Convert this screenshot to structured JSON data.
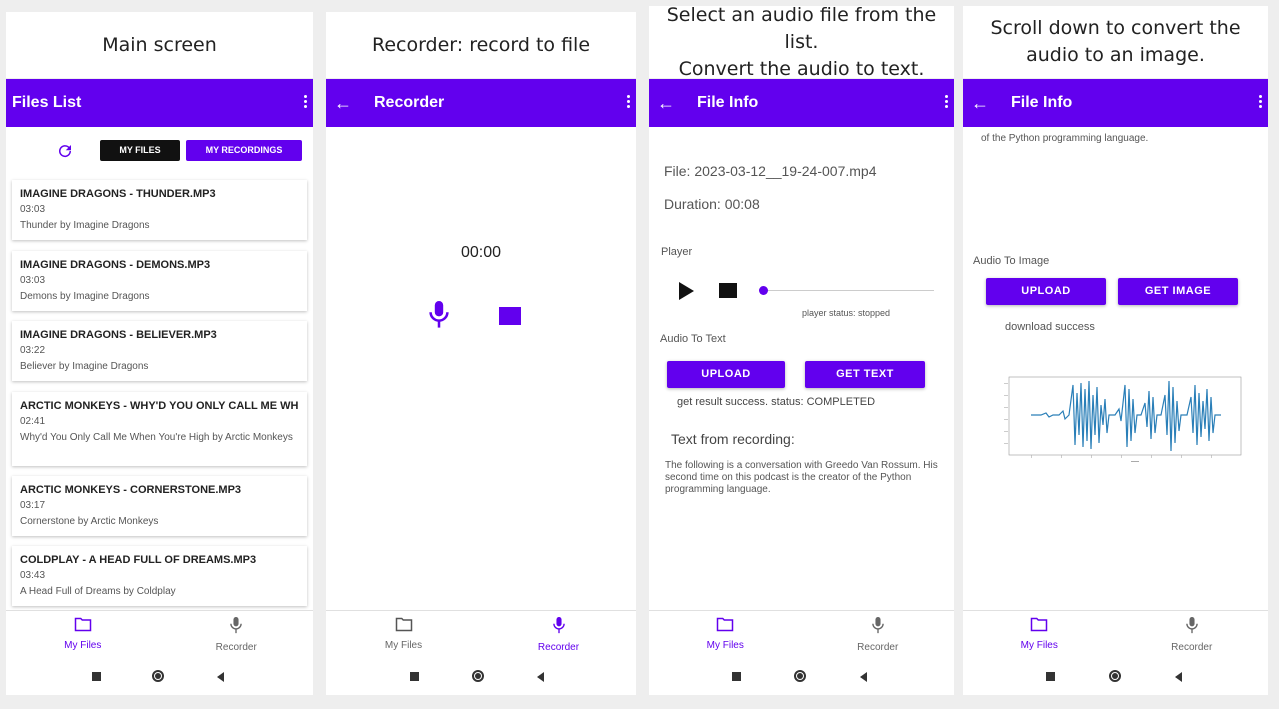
{
  "captions": [
    "Main screen",
    "Recorder: record to file",
    "Select an audio file from the list.\nConvert the audio to text.",
    "Scroll down to convert the\naudio to an image."
  ],
  "nav": {
    "files": "My Files",
    "recorder": "Recorder"
  },
  "screen1": {
    "title": "Files List",
    "tab_files": "MY FILES",
    "tab_recordings": "MY RECORDINGS",
    "items": [
      {
        "title": "IMAGINE DRAGONS - THUNDER.MP3",
        "duration": "03:03",
        "subtitle": "Thunder by Imagine Dragons"
      },
      {
        "title": "IMAGINE DRAGONS - DEMONS.MP3",
        "duration": "03:03",
        "subtitle": "Demons by Imagine Dragons"
      },
      {
        "title": "IMAGINE DRAGONS - BELIEVER.MP3",
        "duration": "03:22",
        "subtitle": "Believer by Imagine Dragons"
      },
      {
        "title": "ARCTIC MONKEYS - WHY'D YOU ONLY CALL ME WHE...",
        "duration": "02:41",
        "subtitle": "Why'd You Only Call Me When You're High by Arctic Monkeys"
      },
      {
        "title": "ARCTIC MONKEYS - CORNERSTONE.MP3",
        "duration": "03:17",
        "subtitle": "Cornerstone by Arctic Monkeys"
      },
      {
        "title": "COLDPLAY - A HEAD FULL OF DREAMS.MP3",
        "duration": "03:43",
        "subtitle": "A Head Full of Dreams by Coldplay"
      }
    ]
  },
  "screen2": {
    "title": "Recorder",
    "timer": "00:00"
  },
  "screen3": {
    "title": "File Info",
    "file": "File: 2023-03-12__19-24-007.mp4",
    "duration": "Duration: 00:08",
    "player_label": "Player",
    "player_status": "player status: stopped",
    "audio_to_text": "Audio To Text",
    "upload": "UPLOAD",
    "get_text": "GET TEXT",
    "result_status": "get result success. status: COMPLETED",
    "text_heading": "Text from recording:",
    "text_body": "The following is a conversation with Greedo Van Rossum. His second time on this podcast is the creator of the Python programming language."
  },
  "screen4": {
    "title": "File Info",
    "scrolled_text": "of the Python programming language.",
    "audio_to_image": "Audio To Image",
    "upload": "UPLOAD",
    "get_image": "GET IMAGE",
    "download_status": "download success"
  },
  "colors": {
    "accent": "#6200ee",
    "waveform": "#2a7fb8"
  }
}
